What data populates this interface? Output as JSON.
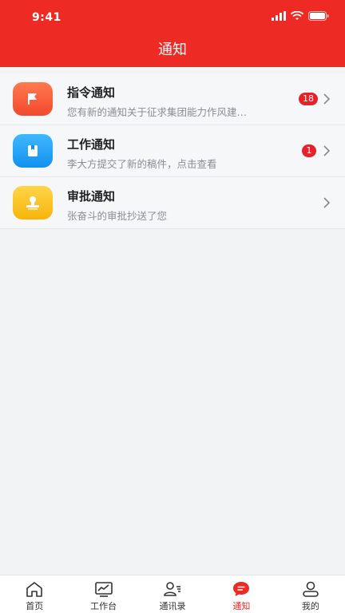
{
  "status_bar": {
    "time": "9:41"
  },
  "header": {
    "title": "通知"
  },
  "notifications": [
    {
      "title": "指令通知",
      "subtitle": "您有新的通知关于征求集团能力作风建…",
      "badge": "18",
      "icon": "flag-icon",
      "color": "#f2492c"
    },
    {
      "title": "工作通知",
      "subtitle": "李大方提交了新的稿件，点击查看",
      "badge": "1",
      "icon": "bookmark-icon",
      "color": "#1390f0"
    },
    {
      "title": "审批通知",
      "subtitle": "张奋斗的审批抄送了您",
      "badge": "",
      "icon": "stamp-icon",
      "color": "#f7b40a"
    }
  ],
  "tabbar": {
    "items": [
      {
        "label": "首页",
        "icon": "home-icon"
      },
      {
        "label": "工作台",
        "icon": "chart-monitor-icon"
      },
      {
        "label": "通讯录",
        "icon": "contacts-icon"
      },
      {
        "label": "通知",
        "icon": "message-icon",
        "active": true
      },
      {
        "label": "我的",
        "icon": "profile-icon"
      }
    ]
  },
  "colors": {
    "accent": "#ee2a24",
    "badge": "#e8202a"
  }
}
